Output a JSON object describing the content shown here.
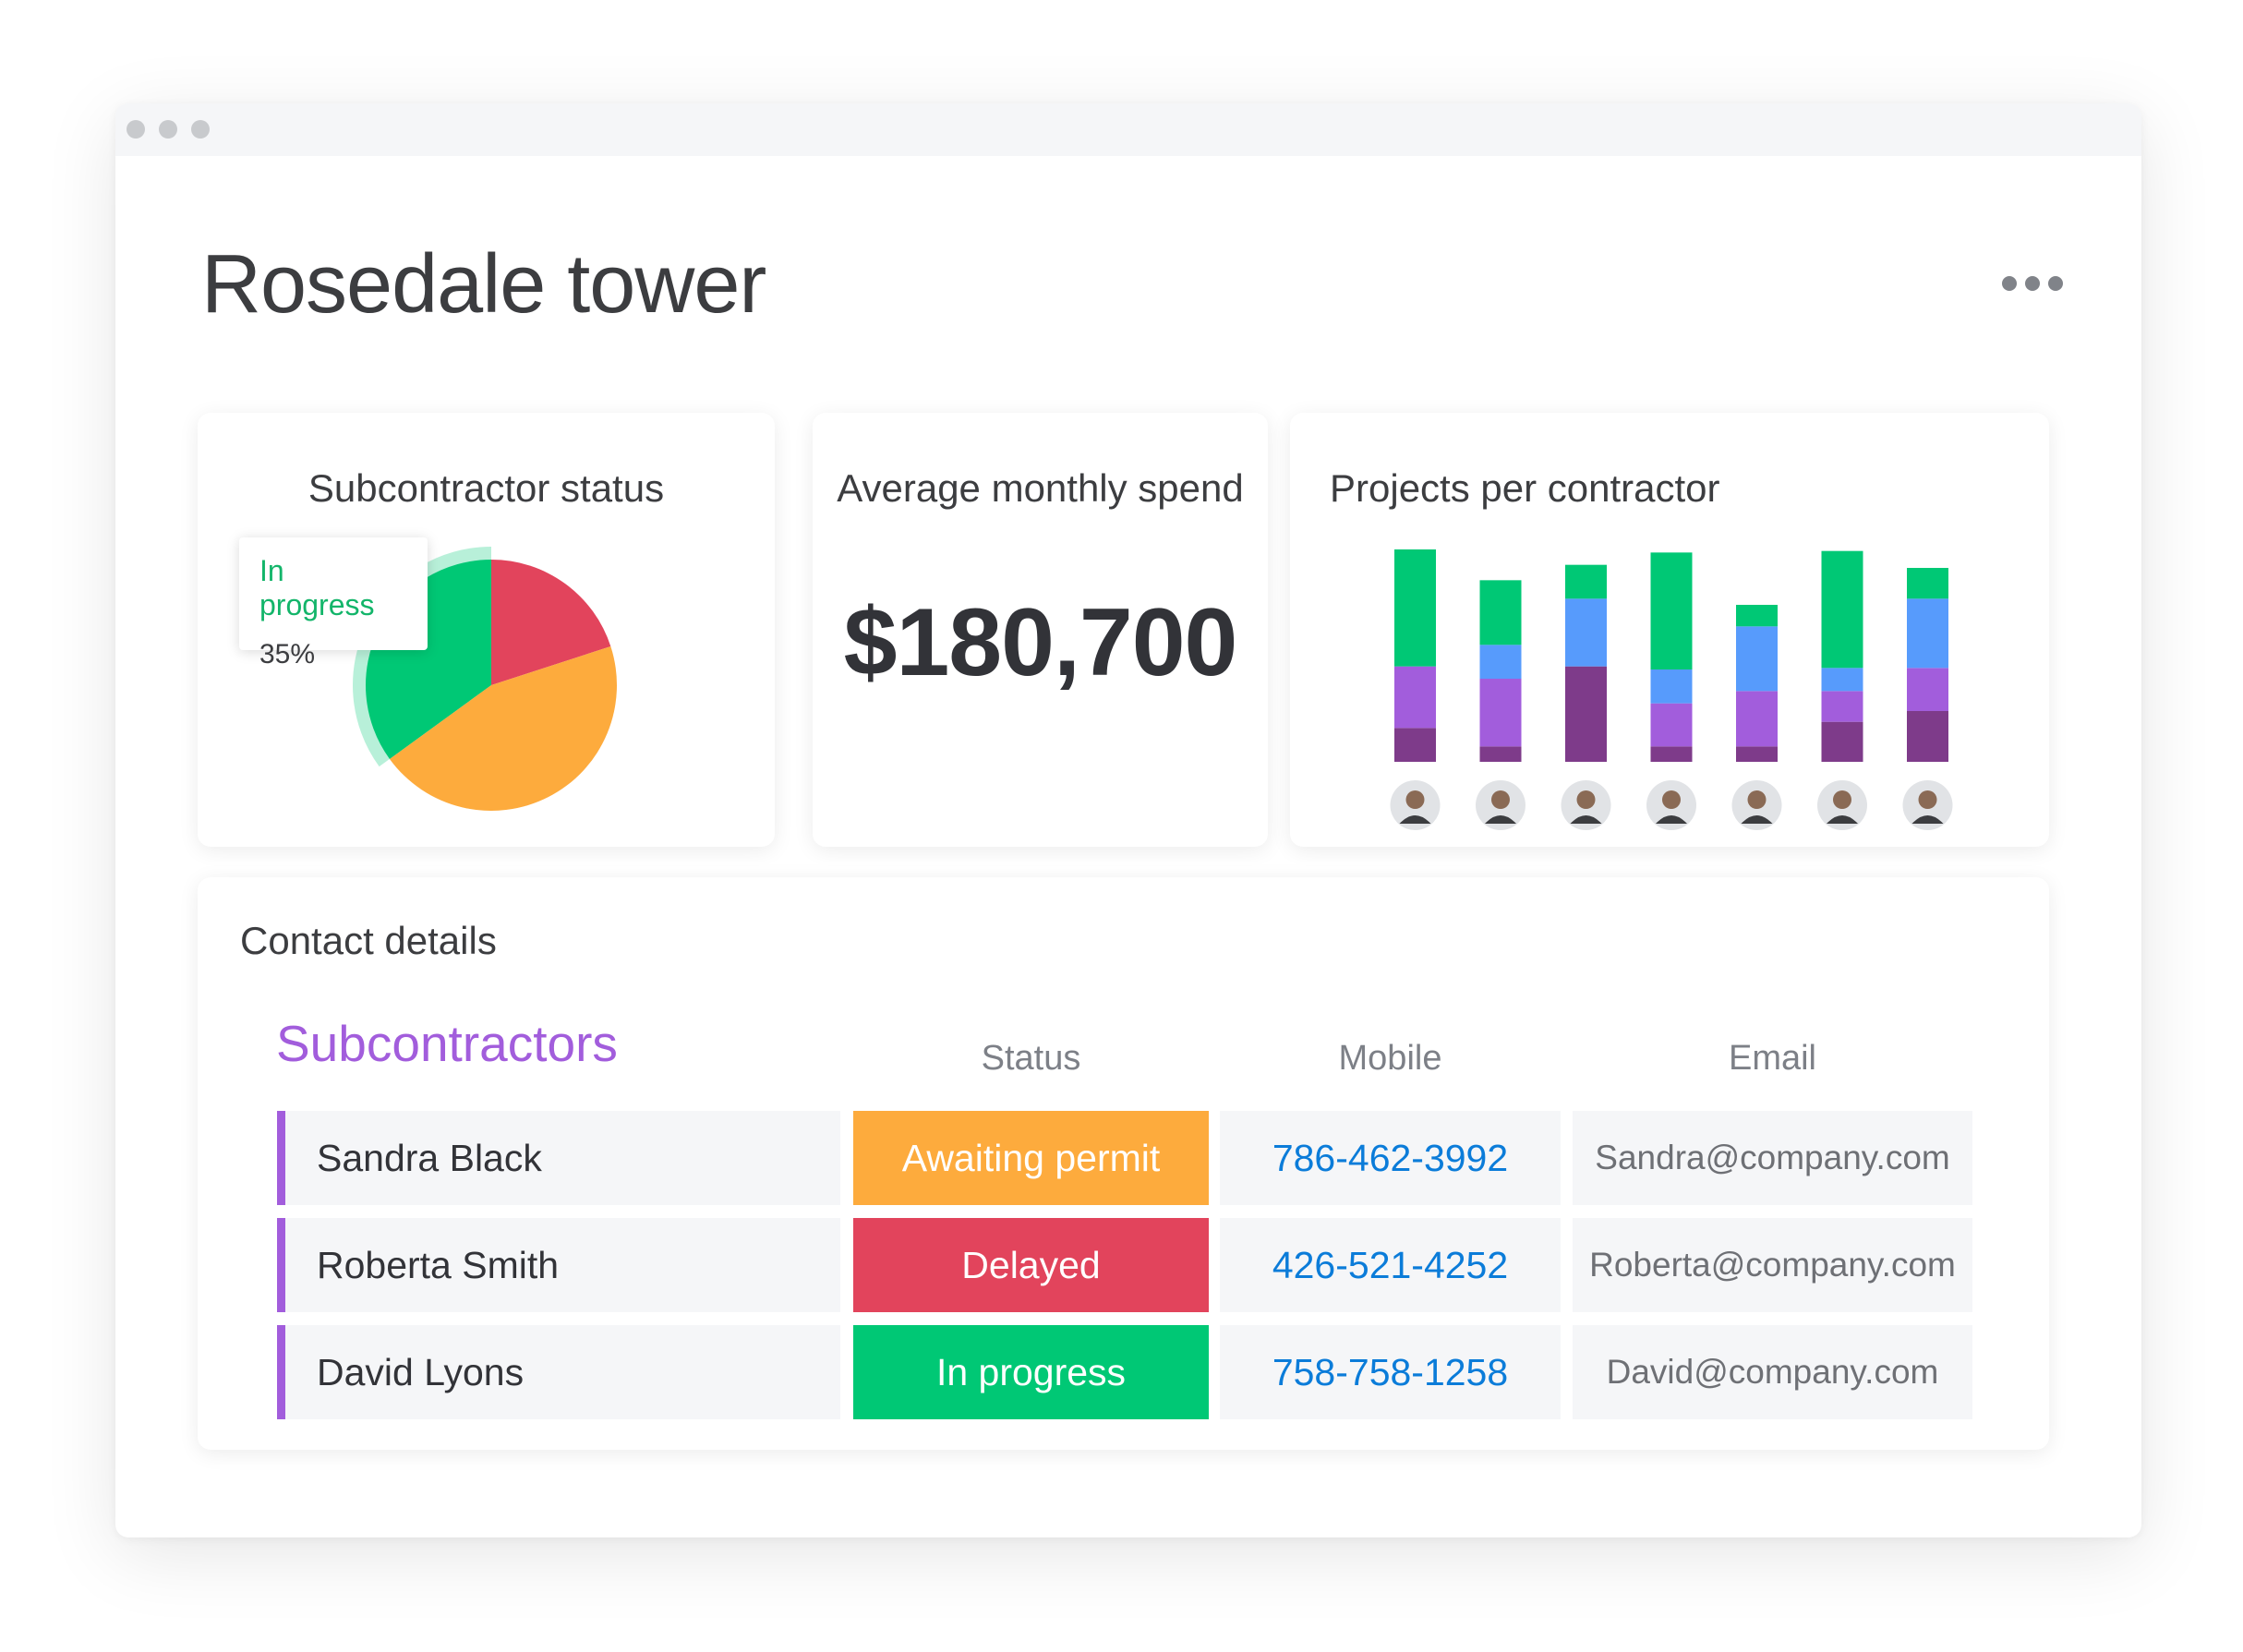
{
  "page": {
    "title": "Rosedale tower"
  },
  "widgets": {
    "status": {
      "title": "Subcontractor status",
      "tooltip_label": "In progress",
      "tooltip_value": "35%"
    },
    "spend": {
      "title": "Average monthly spend",
      "value": "$180,700"
    },
    "projects": {
      "title": "Projects per contractor"
    }
  },
  "contacts": {
    "title": "Contact details",
    "group_title": "Subcontractors",
    "columns": {
      "status": "Status",
      "mobile": "Mobile",
      "email": "Email"
    },
    "rows": [
      {
        "name": "Sandra Black",
        "status": "Awaiting permit",
        "status_color": "#fdab3d",
        "mobile": "786-462-3992",
        "email": "Sandra@company.com"
      },
      {
        "name": "Roberta Smith",
        "status": "Delayed",
        "status_color": "#e2445c",
        "mobile": "426-521-4252",
        "email": "Roberta@company.com"
      },
      {
        "name": "David Lyons",
        "status": "In progress",
        "status_color": "#00c875",
        "mobile": "758-758-1258",
        "email": "David@company.com"
      }
    ]
  },
  "chart_data": [
    {
      "type": "pie",
      "labels": [
        "In progress",
        "Delayed",
        "Awaiting permit"
      ],
      "values": [
        35,
        20,
        45
      ],
      "colors": [
        "#00c875",
        "#e2445c",
        "#fdab3d"
      ],
      "highlighted": "In progress"
    },
    {
      "type": "bar",
      "stacked": true,
      "category_icons": [
        "avatar-icon",
        "avatar-icon",
        "avatar-icon",
        "avatar-icon",
        "avatar-icon",
        "avatar-icon",
        "avatar-icon"
      ],
      "series": [
        {
          "color": "#7e3b8a",
          "values": [
            22,
            10,
            62,
            10,
            10,
            26,
            33
          ]
        },
        {
          "color": "#a25ddc",
          "values": [
            40,
            44,
            0,
            28,
            36,
            20,
            28
          ]
        },
        {
          "color": "#579bfc",
          "values": [
            0,
            22,
            44,
            22,
            42,
            15,
            45
          ]
        },
        {
          "color": "#00c875",
          "values": [
            76,
            42,
            22,
            76,
            14,
            76,
            20
          ]
        }
      ],
      "ylim": [
        0,
        150
      ],
      "grid": false,
      "legend": "none"
    }
  ]
}
